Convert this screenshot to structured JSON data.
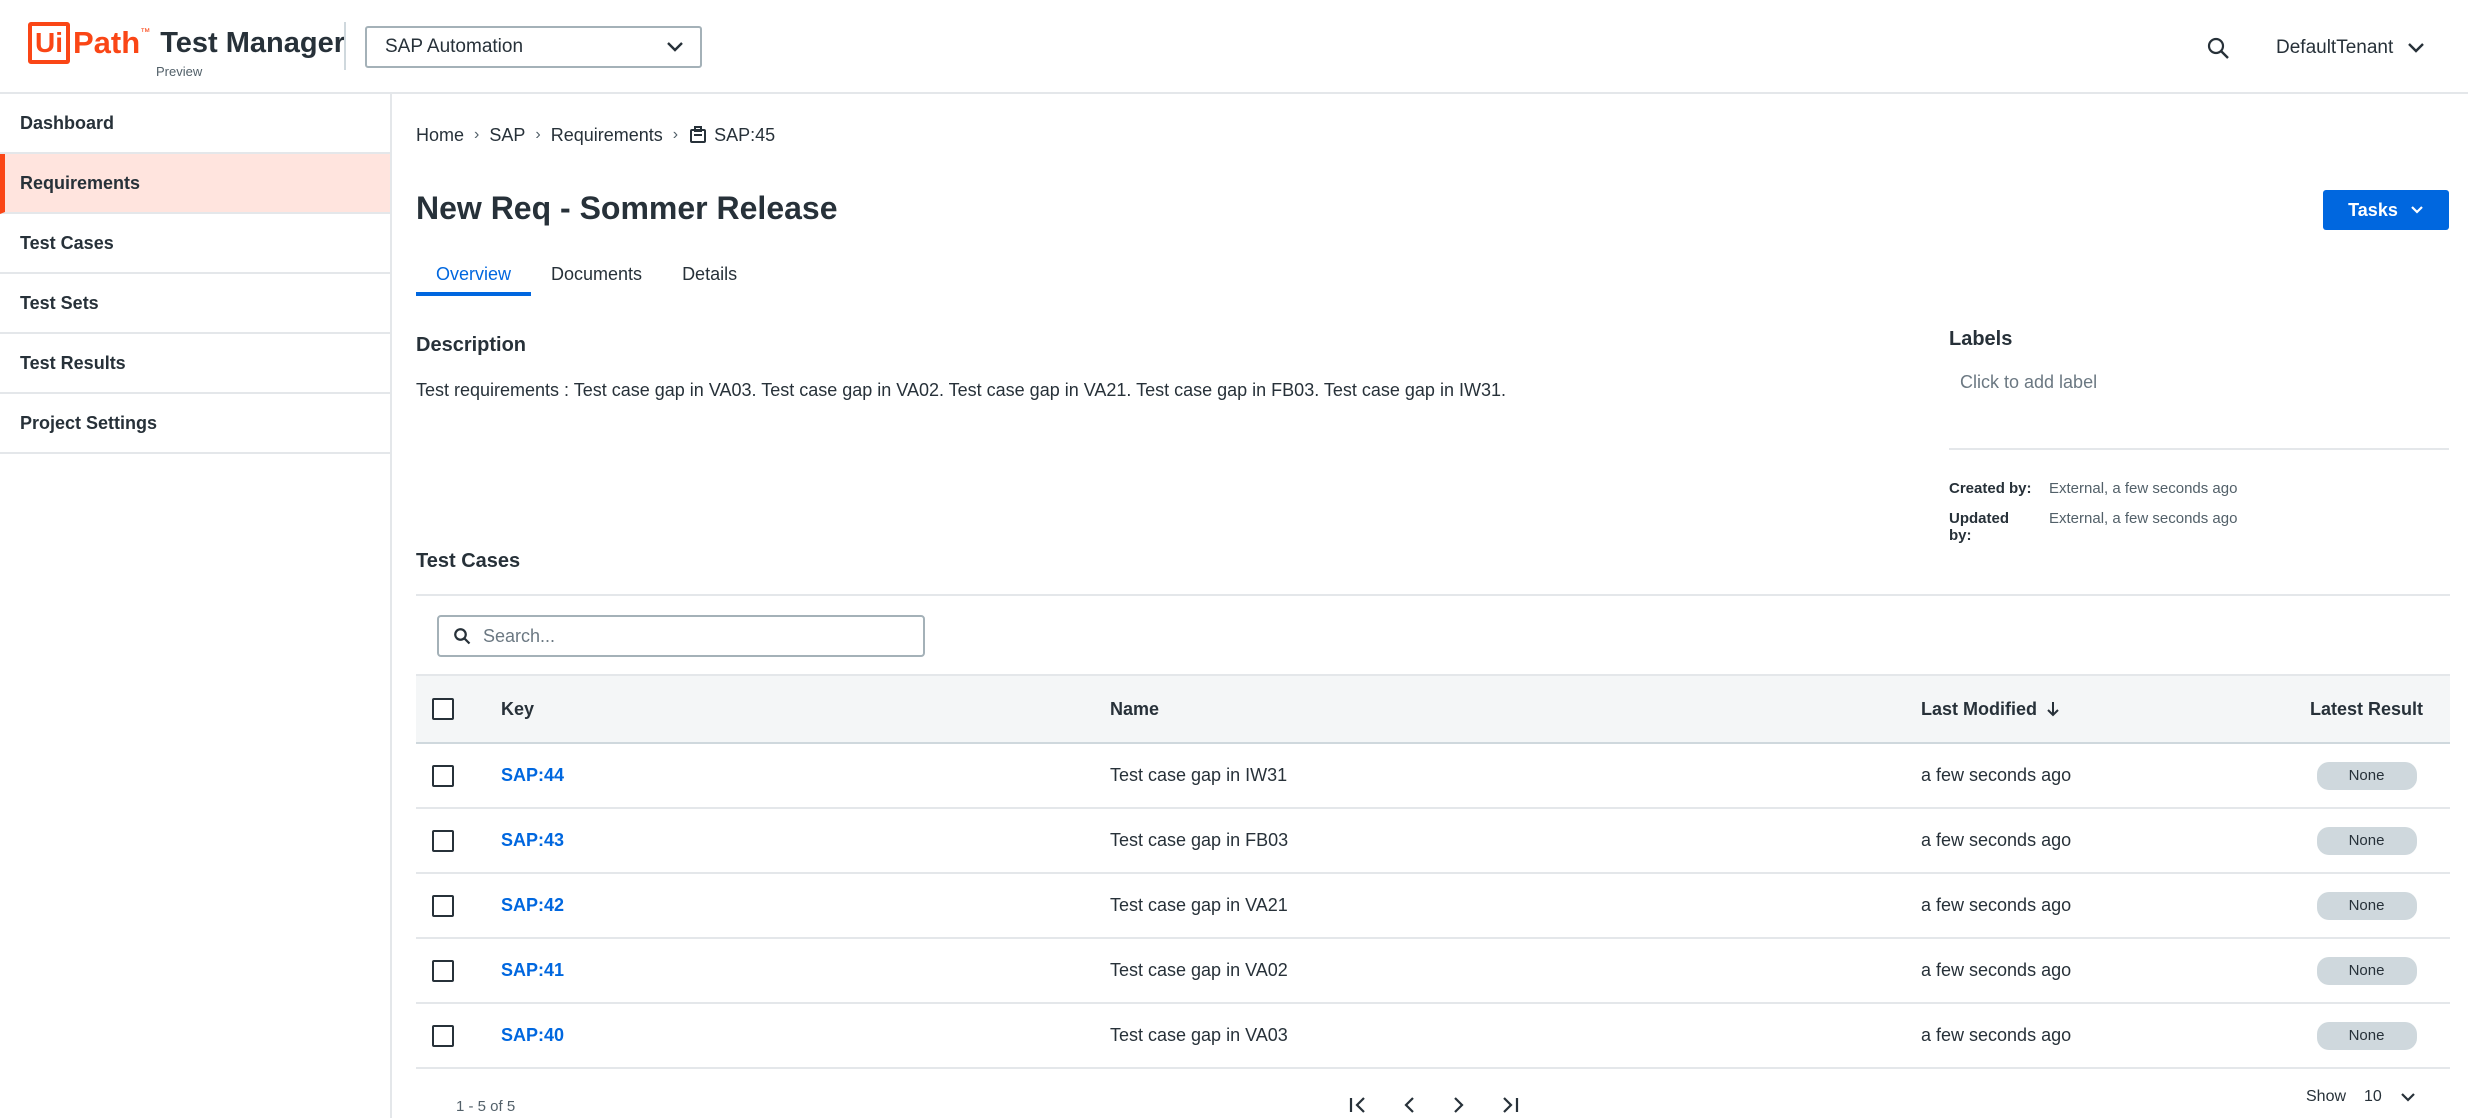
{
  "header": {
    "logo_box": "Ui",
    "logo_path": "Path",
    "logo_tm": "™",
    "product": "Test Manager",
    "preview": "Preview",
    "project": "SAP Automation",
    "tenant": "DefaultTenant"
  },
  "sidebar": {
    "items": [
      {
        "label": "Dashboard"
      },
      {
        "label": "Requirements"
      },
      {
        "label": "Test Cases"
      },
      {
        "label": "Test Sets"
      },
      {
        "label": "Test Results"
      },
      {
        "label": "Project Settings"
      }
    ],
    "active": "Requirements"
  },
  "breadcrumb": [
    "Home",
    "SAP",
    "Requirements",
    "SAP:45"
  ],
  "page": {
    "title": "New Req - Sommer Release",
    "tasks_label": "Tasks",
    "tabs": [
      "Overview",
      "Documents",
      "Details"
    ],
    "active_tab": "Overview"
  },
  "description": {
    "heading": "Description",
    "text": "Test requirements : Test case gap in VA03. Test case gap in VA02. Test case gap in VA21. Test case gap in FB03. Test case gap in IW31."
  },
  "labels": {
    "heading": "Labels",
    "add_placeholder": "Click to add label"
  },
  "meta": {
    "created_label": "Created by:",
    "created_value": "External, a few seconds ago",
    "updated_label": "Updated by:",
    "updated_value": "External, a few seconds ago"
  },
  "test_cases": {
    "heading": "Test Cases",
    "search_placeholder": "Search...",
    "columns": [
      "Key",
      "Name",
      "Last Modified",
      "Latest Result"
    ],
    "rows": [
      {
        "key": "SAP:44",
        "name": "Test case gap in IW31",
        "modified": "a few seconds ago",
        "result": "None"
      },
      {
        "key": "SAP:43",
        "name": "Test case gap in FB03",
        "modified": "a few seconds ago",
        "result": "None"
      },
      {
        "key": "SAP:42",
        "name": "Test case gap in VA21",
        "modified": "a few seconds ago",
        "result": "None"
      },
      {
        "key": "SAP:41",
        "name": "Test case gap in VA02",
        "modified": "a few seconds ago",
        "result": "None"
      },
      {
        "key": "SAP:40",
        "name": "Test case gap in VA03",
        "modified": "a few seconds ago",
        "result": "None"
      }
    ]
  },
  "pagination": {
    "count": "1 - 5 of 5",
    "show_label": "Show",
    "page_size": "10"
  },
  "colors": {
    "brand": "#fa4616",
    "accent": "#0067df",
    "active_nav_bg": "#ffe4de"
  }
}
